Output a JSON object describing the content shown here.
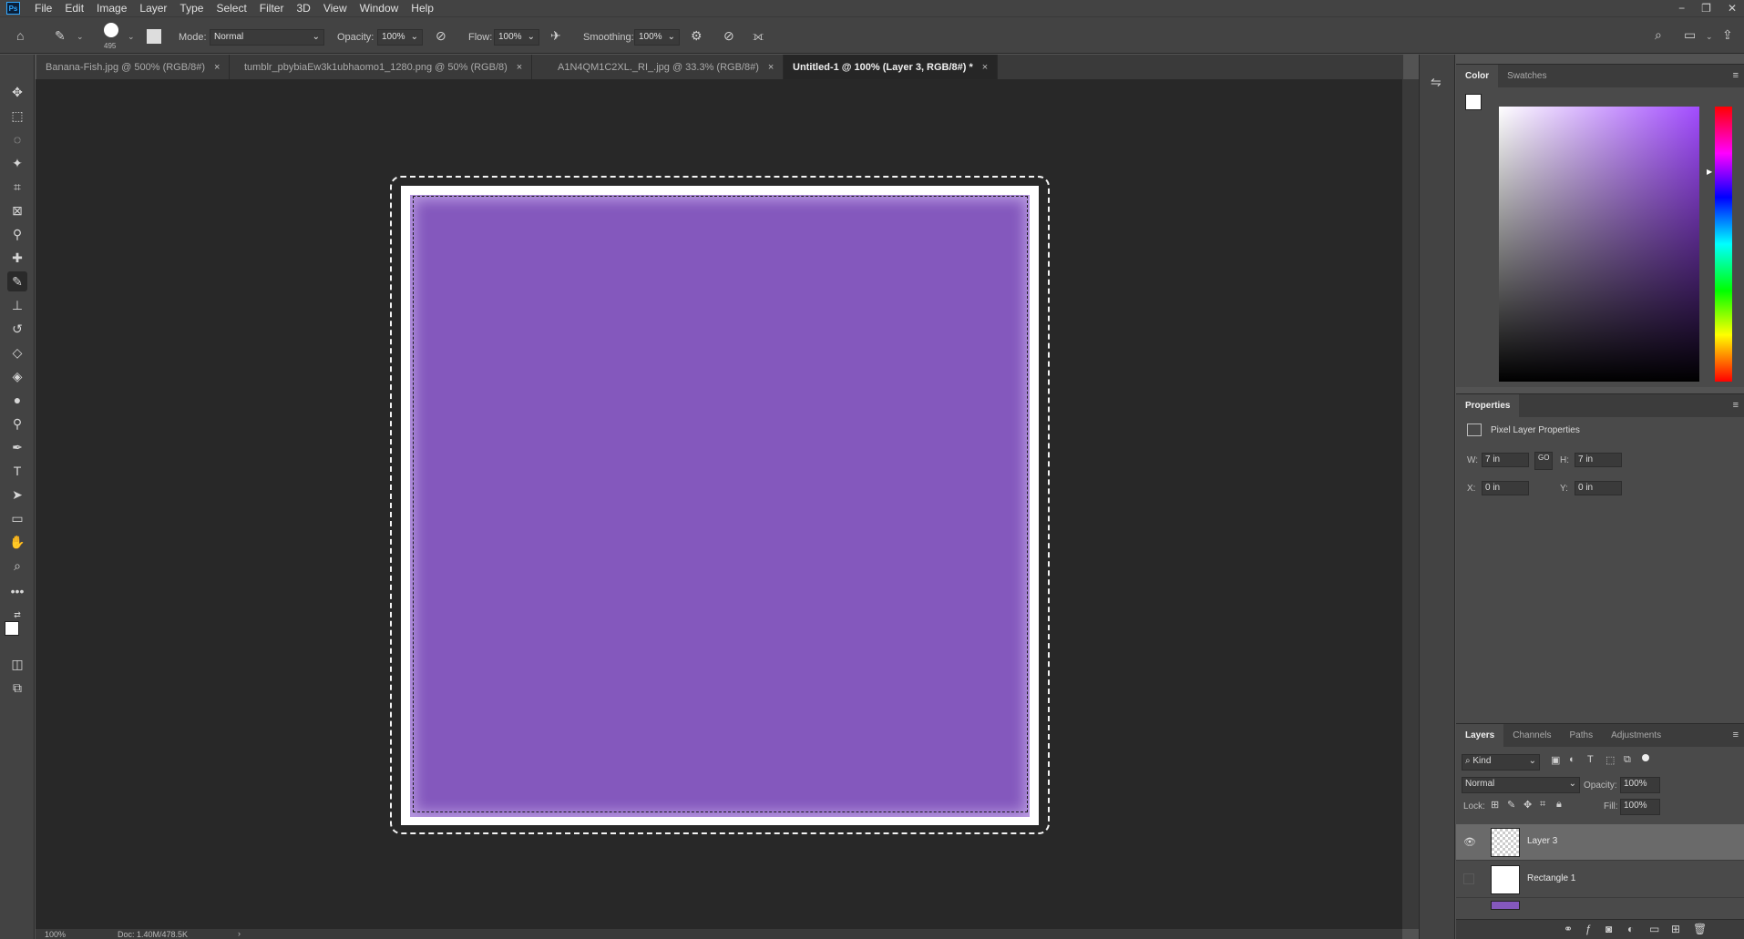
{
  "app": {
    "logo": "Ps"
  },
  "menu": [
    "File",
    "Edit",
    "Image",
    "Layer",
    "Type",
    "Select",
    "Filter",
    "3D",
    "View",
    "Window",
    "Help"
  ],
  "window_controls": {
    "minimize": "−",
    "restore": "❐",
    "close": "✕"
  },
  "options": {
    "brush_size": "495",
    "mode_label": "Mode:",
    "mode_value": "Normal",
    "opacity_label": "Opacity:",
    "opacity_value": "100%",
    "flow_label": "Flow:",
    "flow_value": "100%",
    "smoothing_label": "Smoothing:",
    "smoothing_value": "100%"
  },
  "tabs": [
    {
      "label": "Banana-Fish.jpg @ 500% (RGB/8#)",
      "close": "×"
    },
    {
      "label": "tumblr_pbybiaEw3k1ubhaomo1_1280.png @ 50% (RGB/8)",
      "close": "×"
    },
    {
      "label": "A1N4QM1C2XL._RI_.jpg @ 33.3% (RGB/8#)",
      "close": "×"
    },
    {
      "label": "Untitled-1 @ 100% (Layer 3, RGB/8#) *",
      "close": "×"
    }
  ],
  "status": {
    "zoom": "100%",
    "doc": "Doc: 1.40M/478.5K",
    "arrow": "›"
  },
  "color_panel": {
    "tabs": [
      "Color",
      "Swatches"
    ],
    "accent_purple": "#8458bd"
  },
  "properties": {
    "title": "Properties",
    "subtitle": "Pixel Layer Properties",
    "w_label": "W:",
    "w_value": "7 in",
    "h_label": "H:",
    "h_value": "7 in",
    "x_label": "X:",
    "x_value": "0 in",
    "y_label": "Y:",
    "y_value": "0 in",
    "link": "GO"
  },
  "layers_panel": {
    "tabs": [
      "Layers",
      "Channels",
      "Paths",
      "Adjustments"
    ],
    "kind_label": "Kind",
    "blend_mode": "Normal",
    "opacity_label": "Opacity:",
    "opacity_value": "100%",
    "lock_label": "Lock:",
    "fill_label": "Fill:",
    "fill_value": "100%",
    "layers": [
      {
        "name": "Layer 3",
        "visible": true,
        "selected": true
      },
      {
        "name": "Rectangle 1",
        "visible": false,
        "selected": false
      }
    ]
  }
}
